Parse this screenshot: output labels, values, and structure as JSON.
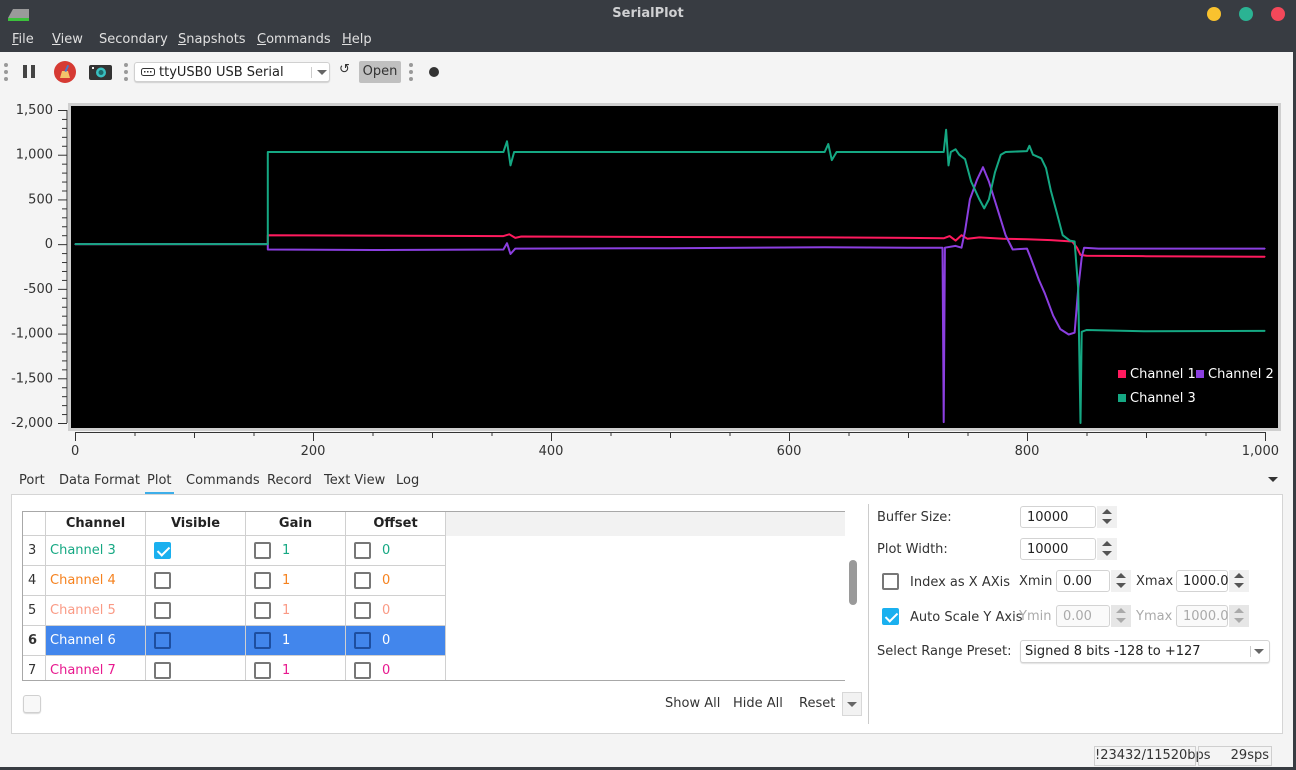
{
  "window": {
    "title": "SerialPlot",
    "controls": [
      {
        "name": "minimize",
        "color": "#f9c22e"
      },
      {
        "name": "maximize",
        "color": "#2bb393"
      },
      {
        "name": "close",
        "color": "#f4485a"
      }
    ]
  },
  "menubar": {
    "items": [
      {
        "label": "File",
        "mnemonic": "F",
        "rest": "ile"
      },
      {
        "label": "View",
        "mnemonic": "V",
        "rest": "iew"
      },
      {
        "label": "Secondary",
        "mnemonic": "",
        "rest": "Secondary"
      },
      {
        "label": "Snapshots",
        "mnemonic": "S",
        "rest": "napshots"
      },
      {
        "label": "Commands",
        "mnemonic": "C",
        "rest": "ommands"
      },
      {
        "label": "Help",
        "mnemonic": "H",
        "rest": "elp"
      }
    ]
  },
  "toolbar": {
    "pause_icon": "pause-icon",
    "clear_icon": "broom-clear-icon",
    "snapshot_icon": "camera-icon",
    "port_icon": "serial-port-icon",
    "port_value": "ttyUSB0 USB Serial",
    "refresh_glyph": "↺",
    "open_label": "Open",
    "status_led_icon": "status-led-icon"
  },
  "colors": {
    "channel1": "#ff1a5e",
    "channel2": "#8b3fe0",
    "channel3": "#15a883",
    "channel4": "#f5821f",
    "channel5": "#fa9a85",
    "channel6": "#ffffff",
    "channel7": "#e8198f",
    "selection": "#4286ec",
    "check": "#1ab0ef"
  },
  "chart_data": {
    "type": "line",
    "title": "",
    "xlabel": "",
    "ylabel": "",
    "xlim": [
      0,
      1000
    ],
    "ylim": [
      -2000,
      1500
    ],
    "x_ticks": [
      0,
      200,
      400,
      600,
      800,
      1000
    ],
    "x_tick_labels": [
      "0",
      "200",
      "400",
      "600",
      "800",
      "1,000"
    ],
    "y_ticks": [
      1500,
      1000,
      500,
      0,
      -500,
      -1000,
      -1500,
      -2000
    ],
    "y_tick_labels": [
      "1,500",
      "1,000",
      "500",
      "0",
      "-500",
      "-1,000",
      "-1,500",
      "-2,000"
    ],
    "grid": false,
    "background": "#000000",
    "legend": {
      "placement": "bottom-right",
      "entries": [
        "Channel 1",
        "Channel 2",
        "Channel 3"
      ]
    },
    "series": [
      {
        "name": "Channel 1",
        "color": "#ff1a5e",
        "points": [
          [
            0,
            0
          ],
          [
            162,
            0
          ],
          [
            162,
            100
          ],
          [
            250,
            95
          ],
          [
            360,
            90
          ],
          [
            365,
            110
          ],
          [
            370,
            70
          ],
          [
            375,
            85
          ],
          [
            500,
            80
          ],
          [
            630,
            75
          ],
          [
            700,
            70
          ],
          [
            730,
            65
          ],
          [
            735,
            90
          ],
          [
            740,
            40
          ],
          [
            745,
            100
          ],
          [
            750,
            60
          ],
          [
            760,
            75
          ],
          [
            780,
            60
          ],
          [
            800,
            55
          ],
          [
            820,
            45
          ],
          [
            838,
            30
          ],
          [
            842,
            -40
          ],
          [
            845,
            -120
          ],
          [
            850,
            -130
          ],
          [
            900,
            -135
          ],
          [
            1000,
            -140
          ]
        ]
      },
      {
        "name": "Channel 2",
        "color": "#8b3fe0",
        "points": [
          [
            0,
            0
          ],
          [
            162,
            0
          ],
          [
            162,
            -60
          ],
          [
            250,
            -65
          ],
          [
            360,
            -60
          ],
          [
            363,
            10
          ],
          [
            366,
            -110
          ],
          [
            370,
            -50
          ],
          [
            500,
            -45
          ],
          [
            630,
            -35
          ],
          [
            700,
            -40
          ],
          [
            729,
            -40
          ],
          [
            730,
            -1990
          ],
          [
            731,
            -40
          ],
          [
            740,
            -20
          ],
          [
            745,
            -40
          ],
          [
            748,
            150
          ],
          [
            752,
            500
          ],
          [
            758,
            720
          ],
          [
            763,
            860
          ],
          [
            768,
            700
          ],
          [
            775,
            400
          ],
          [
            782,
            100
          ],
          [
            788,
            -60
          ],
          [
            800,
            -50
          ],
          [
            803,
            -150
          ],
          [
            810,
            -400
          ],
          [
            815,
            -550
          ],
          [
            822,
            -800
          ],
          [
            828,
            -950
          ],
          [
            835,
            -1010
          ],
          [
            840,
            -990
          ],
          [
            843,
            -500
          ],
          [
            846,
            -150
          ],
          [
            848,
            -40
          ],
          [
            860,
            -50
          ],
          [
            1000,
            -50
          ]
        ]
      },
      {
        "name": "Channel 3",
        "color": "#15a883",
        "points": [
          [
            0,
            0
          ],
          [
            162,
            0
          ],
          [
            162,
            1030
          ],
          [
            360,
            1030
          ],
          [
            363,
            1150
          ],
          [
            366,
            880
          ],
          [
            369,
            1030
          ],
          [
            630,
            1030
          ],
          [
            633,
            1120
          ],
          [
            636,
            940
          ],
          [
            640,
            1030
          ],
          [
            730,
            1030
          ],
          [
            732,
            1280
          ],
          [
            734,
            880
          ],
          [
            736,
            1030
          ],
          [
            740,
            1060
          ],
          [
            743,
            1000
          ],
          [
            748,
            950
          ],
          [
            753,
            700
          ],
          [
            760,
            500
          ],
          [
            764,
            400
          ],
          [
            768,
            500
          ],
          [
            773,
            800
          ],
          [
            778,
            1000
          ],
          [
            782,
            1030
          ],
          [
            800,
            1040
          ],
          [
            802,
            1100
          ],
          [
            805,
            1000
          ],
          [
            812,
            960
          ],
          [
            816,
            850
          ],
          [
            820,
            600
          ],
          [
            825,
            350
          ],
          [
            830,
            100
          ],
          [
            836,
            40
          ],
          [
            840,
            30
          ],
          [
            843,
            -500
          ],
          [
            845,
            -2000
          ],
          [
            846,
            -980
          ],
          [
            850,
            -960
          ],
          [
            900,
            -975
          ],
          [
            1000,
            -970
          ]
        ]
      }
    ]
  },
  "tabs": [
    {
      "label": "Port",
      "active": false
    },
    {
      "label": "Data Format",
      "active": false
    },
    {
      "label": "Plot",
      "active": true
    },
    {
      "label": "Commands",
      "active": false
    },
    {
      "label": "Record",
      "active": false
    },
    {
      "label": "Text View",
      "active": false
    },
    {
      "label": "Log",
      "active": false
    }
  ],
  "channel_table": {
    "headers": [
      "",
      "Channel",
      "Visible",
      "Gain",
      "Offset"
    ],
    "rows": [
      {
        "index": "3",
        "name": "Channel 3",
        "color": "#15a883",
        "visible": true,
        "gain_enabled": false,
        "gain": "1",
        "offset_enabled": false,
        "offset": "0",
        "selected": false
      },
      {
        "index": "4",
        "name": "Channel 4",
        "color": "#f5821f",
        "visible": false,
        "gain_enabled": false,
        "gain": "1",
        "offset_enabled": false,
        "offset": "0",
        "selected": false
      },
      {
        "index": "5",
        "name": "Channel 5",
        "color": "#fa9a85",
        "visible": false,
        "gain_enabled": false,
        "gain": "1",
        "offset_enabled": false,
        "offset": "0",
        "selected": false
      },
      {
        "index": "6",
        "name": "Channel 6",
        "color": "#ffffff",
        "visible": false,
        "gain_enabled": false,
        "gain": "1",
        "offset_enabled": false,
        "offset": "0",
        "selected": true
      },
      {
        "index": "7",
        "name": "Channel 7",
        "color": "#e8198f",
        "visible": false,
        "gain_enabled": false,
        "gain": "1",
        "offset_enabled": false,
        "offset": "0",
        "selected": false
      }
    ]
  },
  "table_buttons": {
    "show_all": "Show All",
    "hide_all": "Hide All",
    "reset": "Reset"
  },
  "plot_settings": {
    "buffer_size_label": "Buffer Size:",
    "buffer_size": "10000",
    "plot_width_label": "Plot Width:",
    "plot_width": "10000",
    "index_as_x_label": "Index as X AXis",
    "index_as_x_checked": false,
    "xmin_label": "Xmin",
    "xmin": "0.00",
    "xmax_label": "Xmax",
    "xmax": "1000.0",
    "auto_scale_label": "Auto Scale Y Axis",
    "auto_scale_checked": true,
    "ymin_label": "Ymin",
    "ymin": "0.00",
    "ymax_label": "Ymax",
    "ymax": "1000.0",
    "range_preset_label": "Select Range Preset:",
    "range_preset": "Signed 8 bits -128 to +127"
  },
  "statusbar": {
    "bps": "!23432/11520bps",
    "sps": "29sps"
  }
}
